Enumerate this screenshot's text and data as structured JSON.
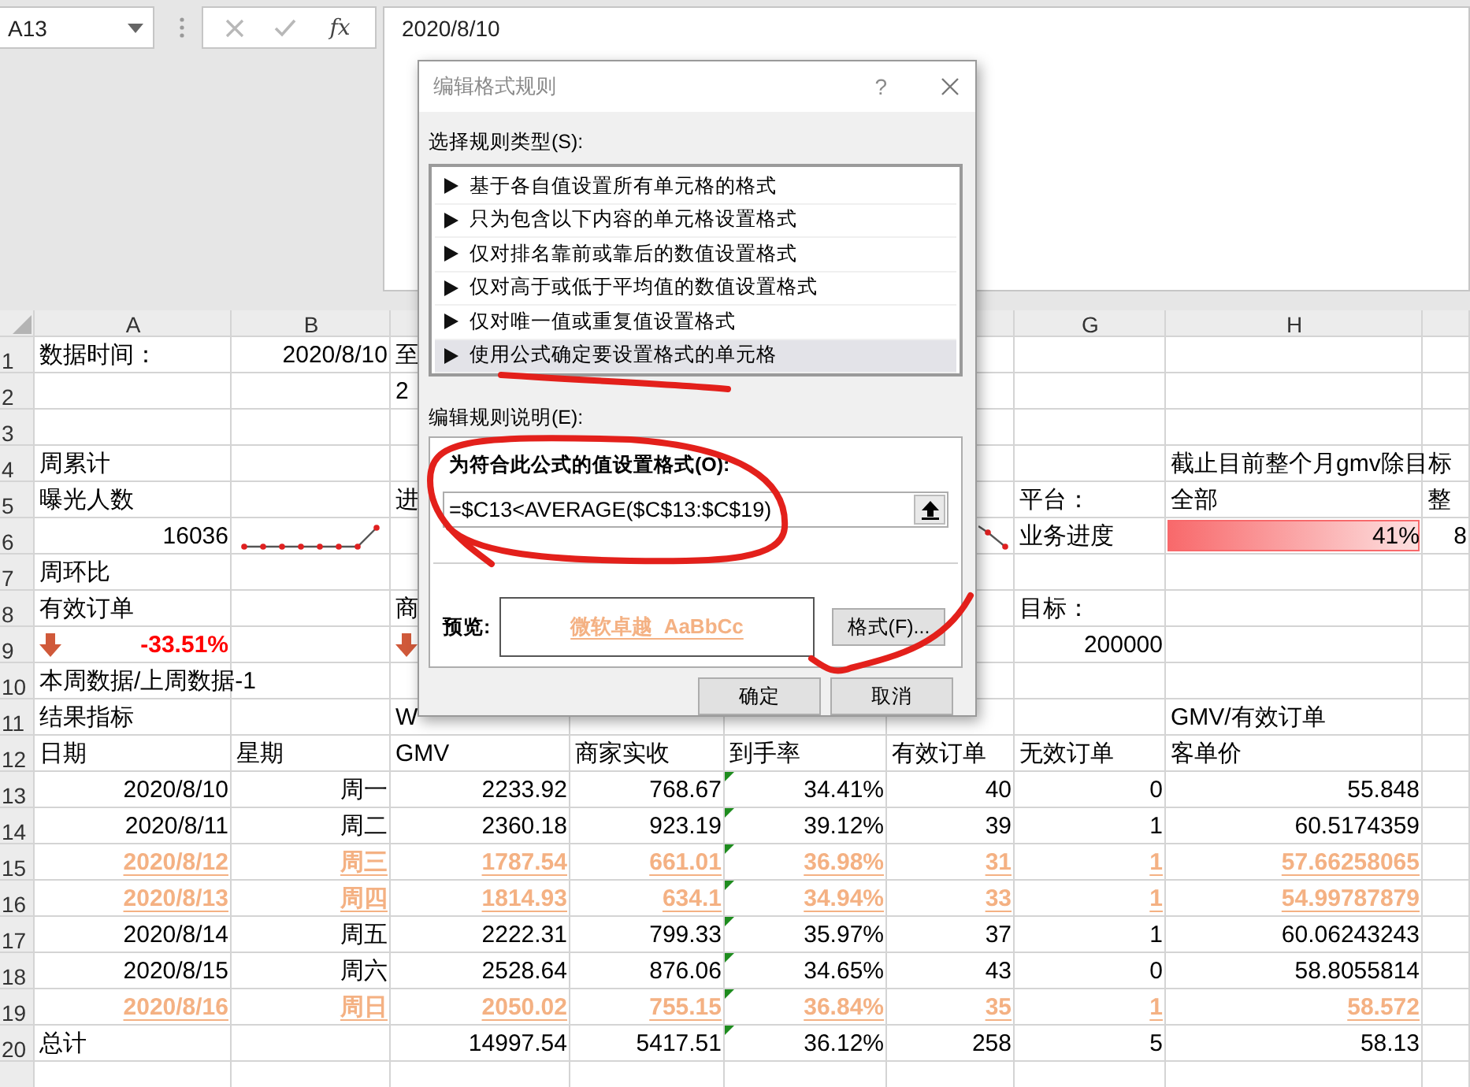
{
  "formula_bar": {
    "name_box": "A13",
    "function_button": "fx",
    "formula": "2020/8/10"
  },
  "sheet": {
    "columns": [
      "A",
      "B",
      null,
      null,
      null,
      null,
      "G",
      "H"
    ],
    "rows": [
      {
        "header": "1",
        "highlighted": false,
        "cells": [
          {
            "kind": "label",
            "text": "数据时间："
          },
          {
            "kind": "value",
            "text": "2020/8/10"
          },
          {
            "kind": "label",
            "text": "至"
          }
        ]
      },
      {
        "header": "2",
        "highlighted": false,
        "cells": [
          null,
          null,
          {
            "kind": "label",
            "text": "2"
          }
        ]
      },
      {
        "header": "3"
      },
      {
        "header": "4",
        "highlighted": false,
        "cells": [
          {
            "kind": "label",
            "text": "周累计"
          },
          null,
          null,
          null,
          null,
          null,
          null,
          {
            "kind": "label",
            "text": "截止目前整个月gmv除目标"
          }
        ]
      },
      {
        "header": "5",
        "highlighted": false,
        "cells": [
          {
            "kind": "label",
            "text": "曝光人数"
          },
          null,
          {
            "kind": "label",
            "text": "进"
          },
          null,
          null,
          null,
          {
            "kind": "label",
            "text": "平台："
          },
          {
            "kind": "label",
            "text": "全部"
          },
          {
            "kind": "label",
            "text": "整"
          }
        ]
      },
      {
        "header": "6",
        "highlighted": false,
        "cells": [
          {
            "kind": "value",
            "text": "16036"
          },
          {
            "kind": "sparkline"
          },
          null,
          null,
          null,
          {
            "kind": "sparkline-end"
          },
          {
            "kind": "label",
            "text": "业务进度"
          },
          {
            "kind": "databar",
            "text": "41%",
            "level": 1
          },
          {
            "kind": "value",
            "text": "8"
          }
        ]
      },
      {
        "header": "7",
        "highlighted": false,
        "cells": [
          {
            "kind": "label",
            "text": "周环比"
          }
        ]
      },
      {
        "header": "8",
        "highlighted": false,
        "cells": [
          {
            "kind": "label",
            "text": "有效订单"
          },
          null,
          {
            "kind": "label",
            "text": "商"
          },
          null,
          null,
          null,
          {
            "kind": "label",
            "text": "目标："
          }
        ]
      },
      {
        "header": "9",
        "highlighted": false,
        "cells": [
          {
            "kind": "trend-down",
            "text": "-33.51%"
          },
          null,
          {
            "kind": "trend-down"
          },
          null,
          null,
          null,
          {
            "kind": "value",
            "text": "200000"
          }
        ]
      },
      {
        "header": "10",
        "highlighted": false,
        "cells": [
          {
            "kind": "label",
            "text": "本周数据/上周数据-1"
          }
        ]
      },
      {
        "header": "11",
        "highlighted": false,
        "cells": [
          {
            "kind": "label",
            "text": "结果指标"
          },
          null,
          {
            "kind": "label",
            "text": "W"
          },
          null,
          null,
          null,
          null,
          {
            "kind": "label",
            "text": "GMV/有效订单"
          }
        ]
      },
      {
        "header": "12",
        "highlighted": false,
        "cells": [
          {
            "kind": "label",
            "text": "日期"
          },
          {
            "kind": "label",
            "text": "星期"
          },
          {
            "kind": "label",
            "text": "GMV"
          },
          {
            "kind": "label",
            "text": "商家实收"
          },
          {
            "kind": "label",
            "text": "到手率"
          },
          {
            "kind": "label",
            "text": "有效订单"
          },
          {
            "kind": "label",
            "text": "无效订单"
          },
          {
            "kind": "label",
            "text": "客单价"
          }
        ]
      },
      {
        "header": "13",
        "highlighted": false,
        "cells": [
          {
            "kind": "value",
            "text": "2020/8/10"
          },
          {
            "kind": "value",
            "text": "周一"
          },
          {
            "kind": "value",
            "text": "2233.92"
          },
          {
            "kind": "value",
            "text": "768.67"
          },
          {
            "kind": "value",
            "text": "34.41%",
            "error_marker": true
          },
          {
            "kind": "value",
            "text": "40"
          },
          {
            "kind": "value",
            "text": "0"
          },
          {
            "kind": "value",
            "text": "55.848"
          }
        ]
      },
      {
        "header": "14",
        "highlighted": false,
        "cells": [
          {
            "kind": "value",
            "text": "2020/8/11"
          },
          {
            "kind": "value",
            "text": "周二"
          },
          {
            "kind": "value",
            "text": "2360.18"
          },
          {
            "kind": "value",
            "text": "923.19"
          },
          {
            "kind": "value",
            "text": "39.12%",
            "error_marker": true
          },
          {
            "kind": "value",
            "text": "39"
          },
          {
            "kind": "value",
            "text": "1"
          },
          {
            "kind": "value",
            "text": "60.5174359"
          }
        ]
      },
      {
        "header": "15",
        "highlighted": true,
        "cells": [
          {
            "kind": "value",
            "text": "2020/8/12"
          },
          {
            "kind": "value",
            "text": "周三"
          },
          {
            "kind": "value",
            "text": "1787.54"
          },
          {
            "kind": "value",
            "text": "661.01"
          },
          {
            "kind": "value",
            "text": "36.98%",
            "error_marker": true
          },
          {
            "kind": "value",
            "text": "31"
          },
          {
            "kind": "value",
            "text": "1"
          },
          {
            "kind": "value",
            "text": "57.66258065"
          }
        ]
      },
      {
        "header": "16",
        "highlighted": true,
        "cells": [
          {
            "kind": "value",
            "text": "2020/8/13"
          },
          {
            "kind": "value",
            "text": "周四"
          },
          {
            "kind": "value",
            "text": "1814.93"
          },
          {
            "kind": "value",
            "text": "634.1"
          },
          {
            "kind": "value",
            "text": "34.94%",
            "error_marker": true
          },
          {
            "kind": "value",
            "text": "33"
          },
          {
            "kind": "value",
            "text": "1"
          },
          {
            "kind": "value",
            "text": "54.99787879"
          }
        ]
      },
      {
        "header": "17",
        "highlighted": false,
        "cells": [
          {
            "kind": "value",
            "text": "2020/8/14"
          },
          {
            "kind": "value",
            "text": "周五"
          },
          {
            "kind": "value",
            "text": "2222.31"
          },
          {
            "kind": "value",
            "text": "799.33"
          },
          {
            "kind": "value",
            "text": "35.97%",
            "error_marker": true
          },
          {
            "kind": "value",
            "text": "37"
          },
          {
            "kind": "value",
            "text": "1"
          },
          {
            "kind": "value",
            "text": "60.06243243"
          }
        ]
      },
      {
        "header": "18",
        "highlighted": false,
        "cells": [
          {
            "kind": "value",
            "text": "2020/8/15"
          },
          {
            "kind": "value",
            "text": "周六"
          },
          {
            "kind": "value",
            "text": "2528.64"
          },
          {
            "kind": "value",
            "text": "876.06"
          },
          {
            "kind": "value",
            "text": "34.65%",
            "error_marker": true
          },
          {
            "kind": "value",
            "text": "43"
          },
          {
            "kind": "value",
            "text": "0"
          },
          {
            "kind": "value",
            "text": "58.8055814"
          }
        ]
      },
      {
        "header": "19",
        "highlighted": true,
        "cells": [
          {
            "kind": "value",
            "text": "2020/8/16"
          },
          {
            "kind": "value",
            "text": "周日"
          },
          {
            "kind": "value",
            "text": "2050.02"
          },
          {
            "kind": "value",
            "text": "755.15"
          },
          {
            "kind": "value",
            "text": "36.84%",
            "error_marker": true
          },
          {
            "kind": "value",
            "text": "35"
          },
          {
            "kind": "value",
            "text": "1"
          },
          {
            "kind": "value",
            "text": "58.572"
          }
        ]
      },
      {
        "header": "20",
        "highlighted": false,
        "cells": [
          {
            "kind": "label",
            "text": "总计"
          },
          null,
          {
            "kind": "value",
            "text": "14997.54"
          },
          {
            "kind": "value",
            "text": "5417.51"
          },
          {
            "kind": "value",
            "text": "36.12%",
            "error_marker": true
          },
          {
            "kind": "value",
            "text": "258"
          },
          {
            "kind": "value",
            "text": "5"
          },
          {
            "kind": "value",
            "text": "58.13"
          }
        ]
      }
    ]
  },
  "dialog": {
    "title": "编辑格式规则",
    "help": "?",
    "rule_type_label": "选择规则类型(S):",
    "rule_types": [
      {
        "label": "基于各自值设置所有单元格的格式",
        "selected": false
      },
      {
        "label": "只为包含以下内容的单元格设置格式",
        "selected": false
      },
      {
        "label": "仅对排名靠前或靠后的数值设置格式",
        "selected": false
      },
      {
        "label": "仅对高于或低于平均值的数值设置格式",
        "selected": false
      },
      {
        "label": "仅对唯一值或重复值设置格式",
        "selected": false
      },
      {
        "label": "使用公式确定要设置格式的单元格",
        "selected": true
      }
    ],
    "description_label": "编辑规则说明(E):",
    "formula_label": "为符合此公式的值设置格式(O):",
    "formula": "=$C13<AVERAGE($C$13:$C$19)",
    "preview_label": "预览:",
    "preview_text": "微软卓越  AaBbCc",
    "format_button": "格式(F)...",
    "ok_button": "确定",
    "cancel_button": "取消"
  }
}
